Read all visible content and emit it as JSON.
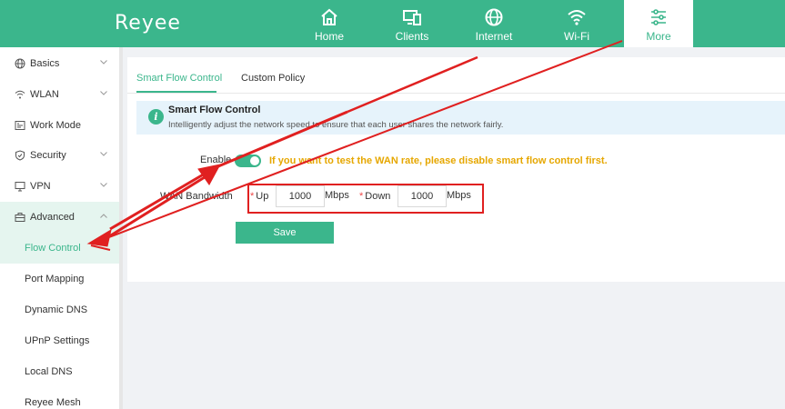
{
  "app": {
    "logo": "Reyee"
  },
  "topnav": [
    {
      "label": "Home",
      "icon": "home-icon"
    },
    {
      "label": "Clients",
      "icon": "clients-icon"
    },
    {
      "label": "Internet",
      "icon": "globe-icon"
    },
    {
      "label": "Wi-Fi",
      "icon": "wifi-icon"
    },
    {
      "label": "More",
      "icon": "sliders-icon",
      "active": true
    }
  ],
  "sidebar": {
    "items": [
      {
        "label": "Basics",
        "icon": "globe-icon",
        "expandable": true
      },
      {
        "label": "WLAN",
        "icon": "wifi-icon",
        "expandable": true
      },
      {
        "label": "Work Mode",
        "icon": "workmode-icon",
        "expandable": false
      },
      {
        "label": "Security",
        "icon": "shield-icon",
        "expandable": true
      },
      {
        "label": "VPN",
        "icon": "monitor-icon",
        "expandable": true
      },
      {
        "label": "Advanced",
        "icon": "briefcase-icon",
        "expandable": true,
        "open": true
      }
    ],
    "subitems": [
      {
        "label": "Flow Control",
        "active": true
      },
      {
        "label": "Port Mapping"
      },
      {
        "label": "Dynamic DNS"
      },
      {
        "label": "UPnP Settings"
      },
      {
        "label": "Local DNS"
      },
      {
        "label": "Reyee Mesh"
      }
    ]
  },
  "tabs": [
    {
      "label": "Smart Flow Control",
      "active": true
    },
    {
      "label": "Custom Policy"
    }
  ],
  "info": {
    "title": "Smart Flow Control",
    "description": "Intelligently adjust the network speed to ensure that each user shares the network fairly."
  },
  "form": {
    "enable_label": "Enable",
    "enabled": true,
    "warning": "If you want to test the WAN rate, please disable smart flow control first.",
    "wan_label": "WAN Bandwidth",
    "up_label": "Up",
    "up_value": "1000",
    "up_unit": "Mbps",
    "down_label": "Down",
    "down_value": "1000",
    "down_unit": "Mbps",
    "required_mark": "*",
    "save_label": "Save"
  },
  "colors": {
    "brand": "#3bb68c",
    "warning": "#e6a700",
    "annotation": "#e02020",
    "info_bg": "#e6f3fb"
  }
}
